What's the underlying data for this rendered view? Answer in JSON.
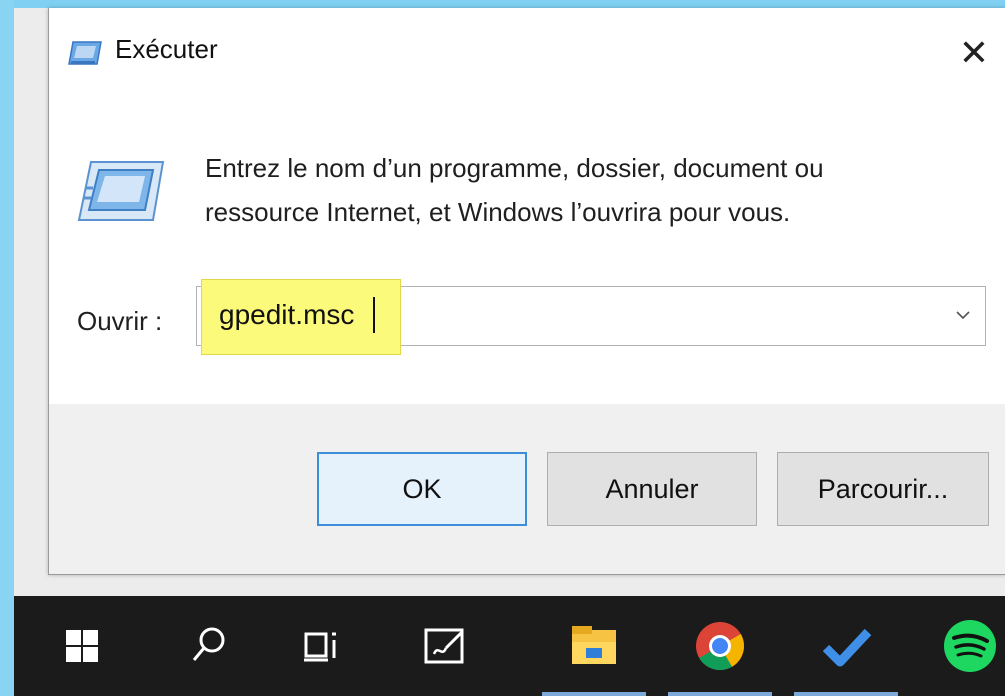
{
  "dialog": {
    "title": "Exécuter",
    "close_glyph": "✕",
    "description_line1": "Entrez le nom d’un programme, dossier, document ou",
    "description_line2": "ressource Internet, et Windows l’ouvrira pour vous.",
    "open_label": "Ouvrir :",
    "open_value": "gpedit.msc",
    "ok_label": "OK",
    "cancel_label": "Annuler",
    "browse_label": "Parcourir..."
  },
  "colors": {
    "highlight": "#fcfa7a",
    "ok_border": "#3d8ed8",
    "taskbar": "#1b1b1b"
  },
  "taskbar": {
    "items": [
      {
        "icon": "windows-start-icon"
      },
      {
        "icon": "search-icon"
      },
      {
        "icon": "task-view-icon"
      },
      {
        "icon": "whiteboard-icon"
      },
      {
        "icon": "file-explorer-icon"
      },
      {
        "icon": "chrome-icon"
      },
      {
        "icon": "todo-checkmark-icon"
      },
      {
        "icon": "spotify-icon"
      }
    ]
  }
}
